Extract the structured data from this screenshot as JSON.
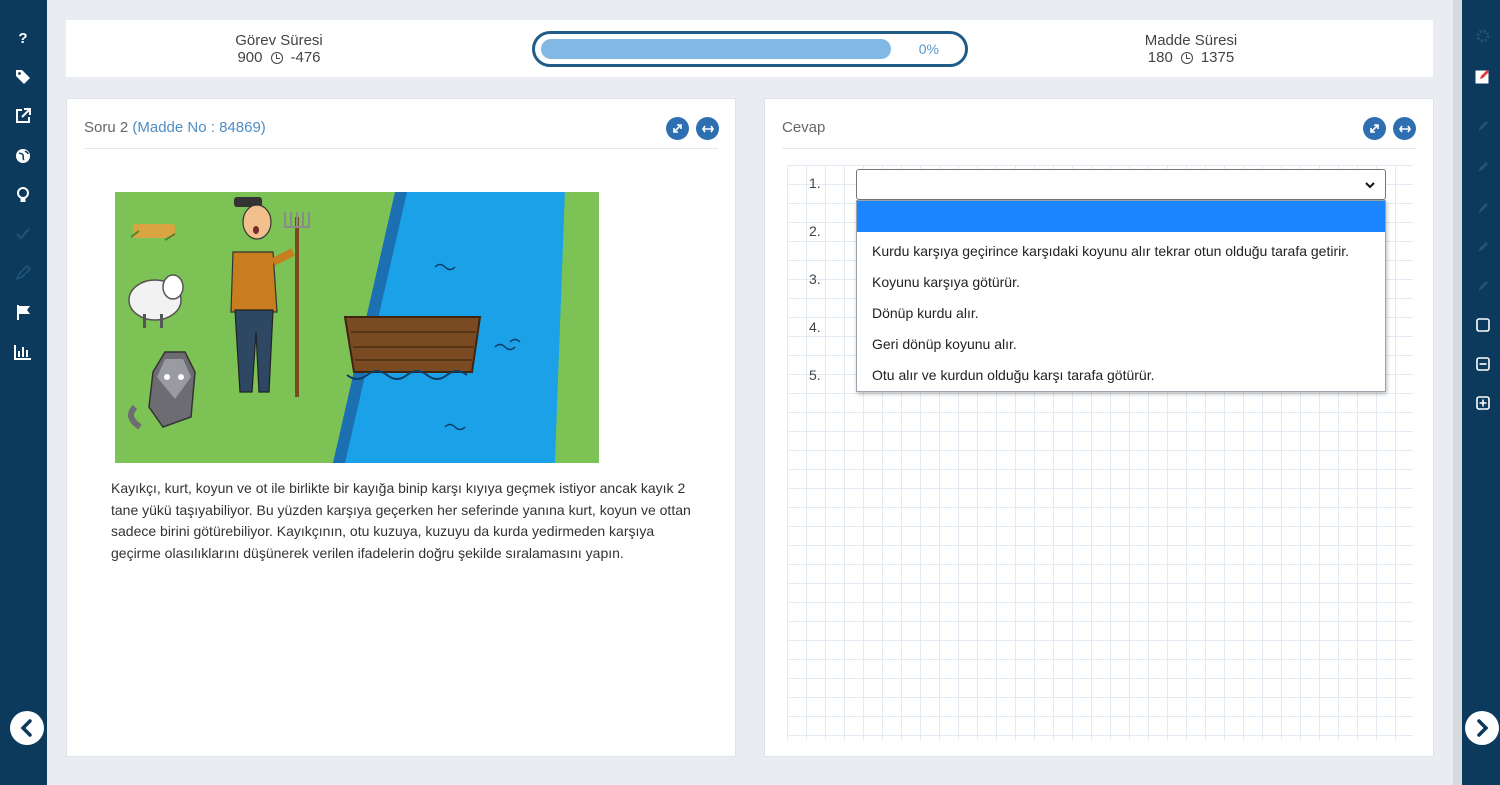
{
  "left_sidebar": {
    "icons": [
      "help-icon",
      "tag-icon",
      "external-link-icon",
      "globe-icon",
      "lightbulb-icon",
      "check-icon",
      "edit-icon",
      "flag-icon",
      "bar-chart-icon"
    ],
    "help_glyph": "?"
  },
  "right_sidebar": {
    "icons": [
      "gear-icon",
      "pencil-box-icon",
      "pen-icon",
      "brush-icon",
      "marker-icon",
      "pencil-icon",
      "eraser-icon",
      "square-icon",
      "minus-box-icon",
      "plus-box-icon"
    ]
  },
  "header": {
    "task_timer": {
      "label": "Görev Süresi",
      "total": "900",
      "remaining": "-476"
    },
    "progress": {
      "fraction": 0,
      "label": "0%"
    },
    "item_timer": {
      "label": "Madde Süresi",
      "total": "180",
      "remaining": "1375"
    }
  },
  "question_panel": {
    "title_prefix": "Soru 2",
    "item_no": "(Madde No : 84869)",
    "text": "Kayıkçı, kurt, koyun ve ot ile birlikte bir kayığa binip karşı kıyıya geçmek istiyor ancak kayık 2 tane yükü taşıyabiliyor. Bu yüzden karşıya geçerken her seferinde yanına kurt, koyun ve ottan sadece birini götürebiliyor. Kayıkçının, otu kuzuya, kuzuyu da kurda yedirmeden karşıya geçirme olasılıklarını düşünerek verilen ifadelerin doğru şekilde sıralamasını yapın."
  },
  "answer_panel": {
    "title": "Cevap",
    "numbers": [
      "1.",
      "2.",
      "3.",
      "4.",
      "5."
    ],
    "select_value": "",
    "dropdown_options": [
      "",
      "Kurdu karşıya geçirince karşıdaki koyunu alır tekrar otun olduğu tarafa getirir.",
      "Koyunu karşıya götürür.",
      "Dönüp kurdu alır.",
      "Geri dönüp koyunu  alır.",
      "Otu alır ve kurdun olduğu karşı tarafa götürür."
    ]
  },
  "colors": {
    "sidebar": "#0b3a5c",
    "accent": "#2e6fb1",
    "progress_fill": "#82b8e4",
    "dropdown_selected": "#1a85ff"
  }
}
